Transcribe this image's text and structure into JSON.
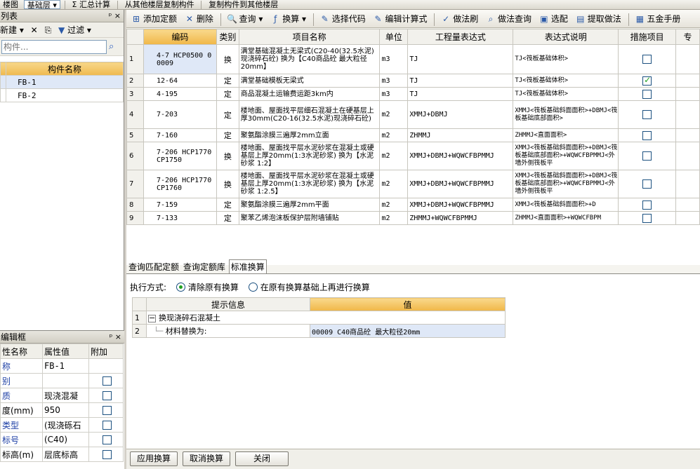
{
  "topbar": {
    "items": [
      "楼图",
      "基础层",
      "Σ 汇总计算",
      "从其他楼层复制构件",
      "复制构件到其他楼层"
    ]
  },
  "left_panel": {
    "title": "列表",
    "pins": "ᵖ ×",
    "new_label": "新建 ▾",
    "delete_icon": "✕",
    "filter_label": "过滤 ▾",
    "search_placeholder": "构件...",
    "column_header": "构件名称",
    "components": [
      {
        "num": "",
        "name": "FB-1"
      },
      {
        "num": "",
        "name": "FB-2"
      }
    ]
  },
  "prop_panel": {
    "title": "编辑框",
    "pins": "ᵖ ×",
    "headers": [
      "性名称",
      "属性值",
      "附加"
    ],
    "rows": [
      {
        "name": "称",
        "value": "FB-1",
        "has_cb": false
      },
      {
        "name": "别",
        "value": "",
        "has_cb": true
      },
      {
        "name": "质",
        "value": "现浇混凝",
        "has_cb": true
      },
      {
        "name": "度(mm)",
        "value": "950",
        "has_cb": true
      },
      {
        "name": "类型",
        "value": "(现浇砾石",
        "has_cb": true
      },
      {
        "name": "标号",
        "value": "(C40)",
        "has_cb": true
      },
      {
        "name": "标高(m)",
        "value": "层底标高",
        "has_cb": true
      }
    ]
  },
  "toolbar": {
    "items": [
      {
        "icon": "⊞",
        "label": "添加定额",
        "name": "add-quota-button"
      },
      {
        "icon": "✕",
        "label": "删除",
        "name": "delete-button"
      },
      {
        "icon": "🔍",
        "label": "查询 ▾",
        "name": "query-button"
      },
      {
        "icon": "ƒ",
        "label": "换算 ▾",
        "name": "convert-button"
      },
      {
        "icon": "✎",
        "label": "选择代码",
        "name": "select-code-button"
      },
      {
        "icon": "✎",
        "label": "编辑计算式",
        "name": "edit-formula-button"
      },
      {
        "icon": "✓",
        "label": "做法刷",
        "name": "method-brush-button"
      },
      {
        "icon": "⌕",
        "label": "做法查询",
        "name": "method-query-button"
      },
      {
        "icon": "▣",
        "label": "选配",
        "name": "match-button"
      },
      {
        "icon": "▤",
        "label": "提取做法",
        "name": "extract-method-button"
      },
      {
        "icon": "▦",
        "label": "五金手册",
        "name": "hardware-manual-button"
      }
    ]
  },
  "grid": {
    "headers": [
      "",
      "编码",
      "类别",
      "项目名称",
      "单位",
      "工程量表达式",
      "表达式说明",
      "措施项目",
      "专"
    ],
    "rows": [
      {
        "n": "1",
        "code": "4-7 HCP0500 0 0009",
        "cat": "换",
        "name": "满堂基础混凝土无梁式(C20-40(32.5水泥)现浇碎石砼) 换为【C40商品砼 最大粒径20mm】",
        "unit": "m3",
        "expr": "TJ",
        "desc": "TJ<筏板基础体积>",
        "checked": false
      },
      {
        "n": "2",
        "code": "12-64",
        "cat": "定",
        "name": "满堂基础模板无梁式",
        "unit": "m3",
        "expr": "TJ",
        "desc": "TJ<筏板基础体积>",
        "checked": true
      },
      {
        "n": "3",
        "code": "4-195",
        "cat": "定",
        "name": "商品混凝土运输费运距3km内",
        "unit": "m3",
        "expr": "TJ",
        "desc": "TJ<筏板基础体积>",
        "checked": false
      },
      {
        "n": "4",
        "code": "7-203",
        "cat": "定",
        "name": "楼地面、屋面找平层细石混凝土在硬基层上厚30mm(C20-16(32.5水泥)现浇碎石砼)",
        "unit": "m2",
        "expr": "XMMJ+DBMJ",
        "desc": "XMMJ<筏板基础斜面面积>+DBMJ<筏板基础底部面积>",
        "checked": false
      },
      {
        "n": "5",
        "code": "7-160",
        "cat": "定",
        "name": "聚氨酯涂膜三遍厚2mm立面",
        "unit": "m2",
        "expr": "ZHMMJ",
        "desc": "ZHMMJ<直面面积>",
        "checked": false
      },
      {
        "n": "6",
        "code": "7-206 HCP1770 CP1750",
        "cat": "换",
        "name": "楼地面、屋面找平层水泥砂浆在混凝土或硬基层上厚20mm(1:3水泥砂浆) 换为【水泥砂浆 1:2】",
        "unit": "m2",
        "expr": "XMMJ+DBMJ+WQWCFBPMMJ",
        "desc": "XMMJ<筏板基础斜面面积>+DBMJ<筏板基础底部面积>+WQWCFBPMMJ<外墙外侧筏板平",
        "checked": false
      },
      {
        "n": "7",
        "code": "7-206 HCP1770 CP1760",
        "cat": "换",
        "name": "楼地面、屋面找平层水泥砂浆在混凝土或硬基层上厚20mm(1:3水泥砂浆) 换为【水泥砂浆 1:2.5】",
        "unit": "m2",
        "expr": "XMMJ+DBMJ+WQWCFBPMMJ",
        "desc": "XMMJ<筏板基础斜面面积>+DBMJ<筏板基础底部面积>+WQWCFBPMMJ<外墙外侧筏板平",
        "checked": false
      },
      {
        "n": "8",
        "code": "7-159",
        "cat": "定",
        "name": "聚氨酯涂膜三遍厚2mm平面",
        "unit": "m2",
        "expr": "XMMJ+DBMJ+WQWCFBPMMJ",
        "desc": "XMMJ<筏板基础斜面面积>+D",
        "checked": false
      },
      {
        "n": "9",
        "code": "7-133",
        "cat": "定",
        "name": "聚苯乙烯泡沫板保护层附墙铺贴",
        "unit": "m2",
        "expr": "ZHMMJ+WQWCFBPMMJ",
        "desc": "ZHMMJ<直面面积>+WQWCFBPM",
        "checked": false
      }
    ]
  },
  "tabs": [
    "查询匹配定额",
    "查询定额库",
    "标准换算"
  ],
  "conversion": {
    "exec_label": "执行方式:",
    "option1": "清除原有换算",
    "option2": "在原有换算基础上再进行换算",
    "headers": [
      "提示信息",
      "值"
    ],
    "row1_n": "1",
    "row1_label": "换现浇碎石混凝土",
    "row2_n": "2",
    "row2_label": "材料替换为:",
    "row2_value": "00009  C40商品砼 最大粒径20mm"
  },
  "buttons": {
    "apply": "应用换算",
    "cancel": "取消换算",
    "close": "关闭"
  }
}
